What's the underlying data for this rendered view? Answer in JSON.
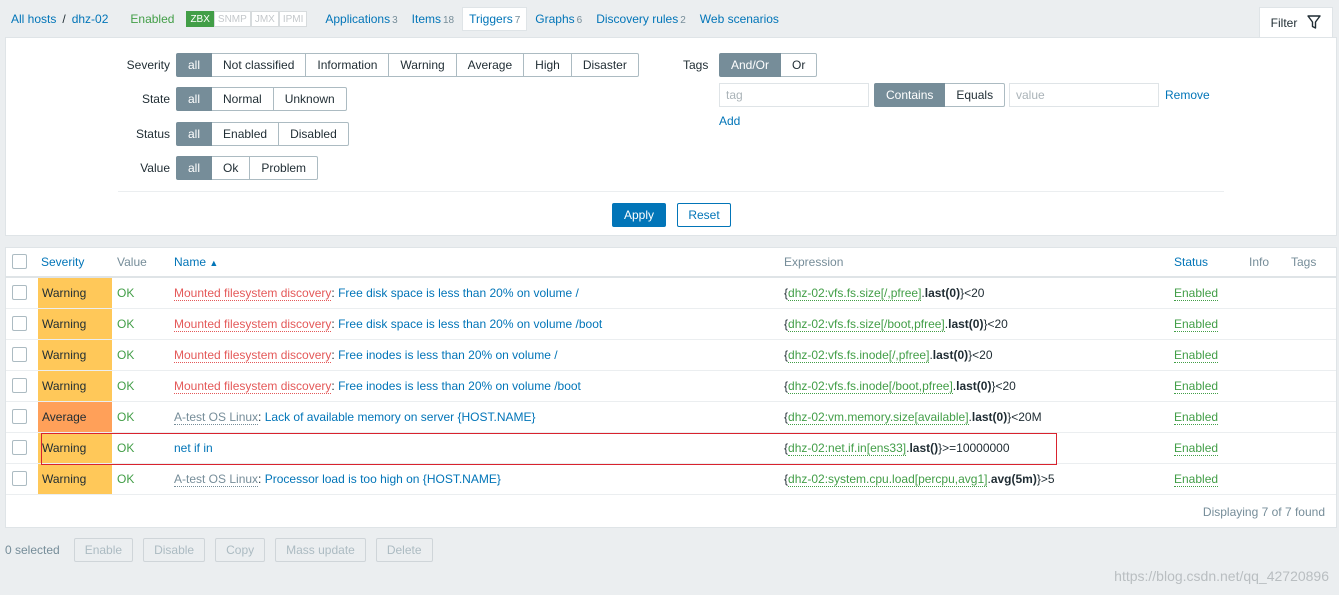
{
  "nav": {
    "crumbs": [
      "All hosts",
      "dhz-02"
    ],
    "separator": "/",
    "host_status": "Enabled",
    "availability": [
      "ZBX",
      "SNMP",
      "JMX",
      "IPMI"
    ],
    "tabs": [
      {
        "label": "Applications",
        "count": "3"
      },
      {
        "label": "Items",
        "count": "18"
      },
      {
        "label": "Triggers",
        "count": "7"
      },
      {
        "label": "Graphs",
        "count": "6"
      },
      {
        "label": "Discovery rules",
        "count": "2"
      },
      {
        "label": "Web scenarios",
        "count": ""
      }
    ],
    "filter_tab": "Filter",
    "filter_icon": "funnel-icon"
  },
  "filter": {
    "severity": {
      "label": "Severity",
      "options": [
        "all",
        "Not classified",
        "Information",
        "Warning",
        "Average",
        "High",
        "Disaster"
      ],
      "selected": "all"
    },
    "state": {
      "label": "State",
      "options": [
        "all",
        "Normal",
        "Unknown"
      ],
      "selected": "all"
    },
    "status": {
      "label": "Status",
      "options": [
        "all",
        "Enabled",
        "Disabled"
      ],
      "selected": "all"
    },
    "value": {
      "label": "Value",
      "options": [
        "all",
        "Ok",
        "Problem"
      ],
      "selected": "all"
    },
    "tags": {
      "label": "Tags",
      "eval_options": [
        "And/Or",
        "Or"
      ],
      "eval_selected": "And/Or",
      "tag_placeholder": "tag",
      "operator_options": [
        "Contains",
        "Equals"
      ],
      "operator_selected": "Contains",
      "value_placeholder": "value",
      "remove": "Remove",
      "add": "Add"
    },
    "apply": "Apply",
    "reset": "Reset"
  },
  "table": {
    "columns": {
      "severity": "Severity",
      "value": "Value",
      "name": "Name",
      "sort_indicator": "▲",
      "expression": "Expression",
      "status": "Status",
      "info": "Info",
      "tags": "Tags"
    },
    "rows": [
      {
        "severity": "Warning",
        "value": "OK",
        "template": "Mounted filesystem discovery",
        "name": "Free disk space is less than 20% on volume /",
        "expr_item": "dhz-02:vfs.fs.size[/,pfree]",
        "expr_fn": "last(0)",
        "expr_tail": "<20",
        "status": "Enabled"
      },
      {
        "severity": "Warning",
        "value": "OK",
        "template": "Mounted filesystem discovery",
        "name": "Free disk space is less than 20% on volume /boot",
        "expr_item": "dhz-02:vfs.fs.size[/boot,pfree]",
        "expr_fn": "last(0)",
        "expr_tail": "<20",
        "status": "Enabled"
      },
      {
        "severity": "Warning",
        "value": "OK",
        "template": "Mounted filesystem discovery",
        "name": "Free inodes is less than 20% on volume /",
        "expr_item": "dhz-02:vfs.fs.inode[/,pfree]",
        "expr_fn": "last(0)",
        "expr_tail": "<20",
        "status": "Enabled"
      },
      {
        "severity": "Warning",
        "value": "OK",
        "template": "Mounted filesystem discovery",
        "name": "Free inodes is less than 20% on volume /boot",
        "expr_item": "dhz-02:vfs.fs.inode[/boot,pfree]",
        "expr_fn": "last(0)",
        "expr_tail": "<20",
        "status": "Enabled"
      },
      {
        "severity": "Average",
        "value": "OK",
        "template": "A-test OS Linux",
        "name": "Lack of available memory on server {HOST.NAME}",
        "expr_item": "dhz-02:vm.memory.size[available]",
        "expr_fn": "last(0)",
        "expr_tail": "<20M",
        "status": "Enabled"
      },
      {
        "severity": "Warning",
        "value": "OK",
        "template": "",
        "name": "net if in",
        "expr_item": "dhz-02:net.if.in[ens33]",
        "expr_fn": "last()",
        "expr_tail": ">=10000000",
        "status": "Enabled"
      },
      {
        "severity": "Warning",
        "value": "OK",
        "template": "A-test OS Linux",
        "name": "Processor load is too high on {HOST.NAME}",
        "expr_item": "dhz-02:system.cpu.load[percpu,avg1]",
        "expr_fn": "avg(5m)",
        "expr_tail": ">5",
        "status": "Enabled"
      }
    ],
    "footer": "Displaying 7 of 7 found"
  },
  "actions": {
    "selected": "0 selected",
    "buttons": [
      "Enable",
      "Disable",
      "Copy",
      "Mass update",
      "Delete"
    ]
  },
  "watermark": "https://blog.csdn.net/qq_42720896",
  "colors": {
    "warning": "#ffc859",
    "average": "#ffa059",
    "link": "#0275b8",
    "ok": "#429e47",
    "highlight": "#d9232e"
  }
}
